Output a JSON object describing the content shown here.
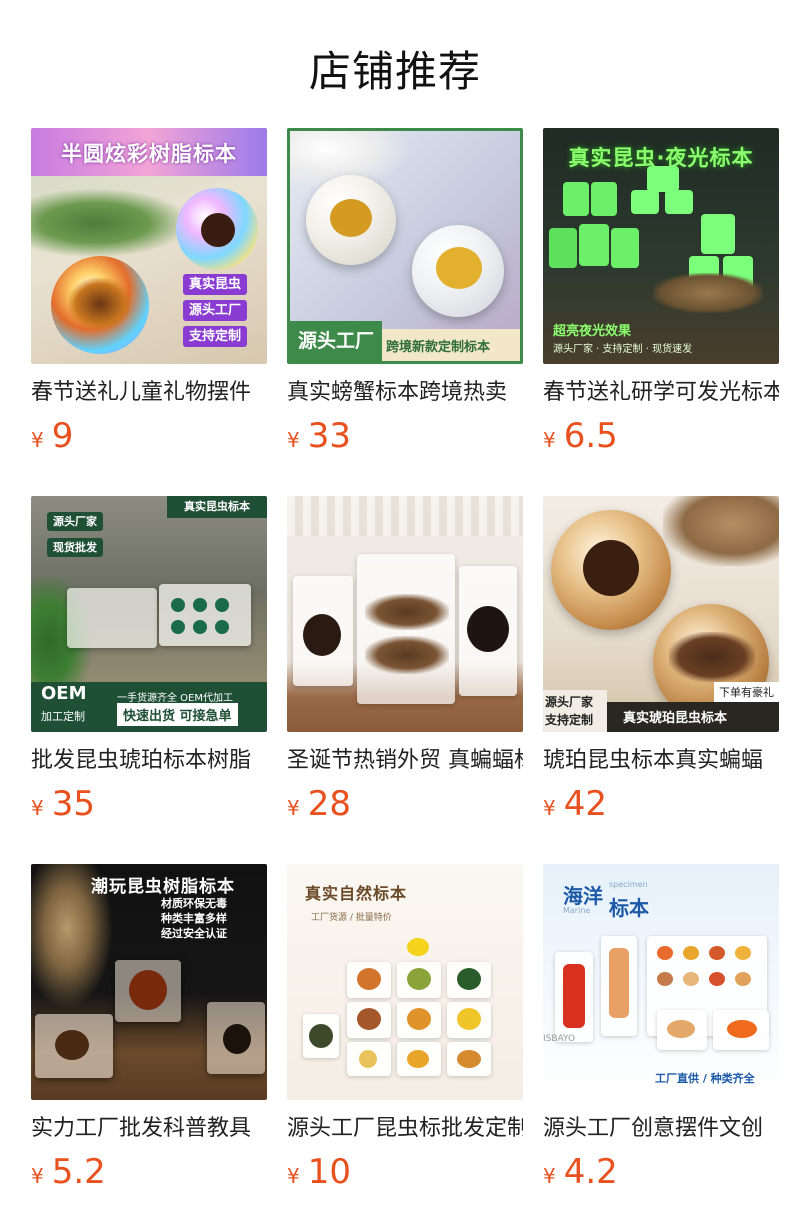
{
  "page": {
    "title": "店铺推荐"
  },
  "products": [
    {
      "name": "春节送礼儿童礼物摆件",
      "price_symbol": "¥",
      "price": "9",
      "image": {
        "headline": "半圆炫彩树脂标本",
        "tags": [
          "真实昆虫",
          "源头工厂",
          "支持定制"
        ]
      }
    },
    {
      "name": "真实螃蟹标本跨境热卖",
      "price_symbol": "¥",
      "price": "33",
      "image": {
        "banner_left": "源头工厂",
        "banner_right": "跨境新款定制标本"
      }
    },
    {
      "name": "春节送礼研学可发光标本",
      "price_symbol": "¥",
      "price": "6.5",
      "image": {
        "headline": "真实昆虫·夜光标本",
        "subline": "超亮夜光效果",
        "footer": "源头厂家 · 支持定制 · 现货速发"
      }
    },
    {
      "name": "批发昆虫琥珀标本树脂",
      "price_symbol": "¥",
      "price": "35",
      "image": {
        "corner": "真实昆虫标本",
        "tags": [
          "源头厂家",
          "现货批发"
        ],
        "oem": "OEM",
        "oem_sub": "加工定制",
        "strip_top": "一手货源齐全 OEM代加工",
        "strip_bottom": "快速出货 可接急单"
      }
    },
    {
      "name": "圣诞节热销外贸 真蝙蝠标本",
      "price_symbol": "¥",
      "price": "28",
      "image": {}
    },
    {
      "name": "琥珀昆虫标本真实蝙蝠",
      "price_symbol": "¥",
      "price": "42",
      "image": {
        "corner": "下单有豪礼",
        "left_line1": "源头厂家",
        "left_line2": "支持定制",
        "right": "真实琥珀昆虫标本"
      }
    },
    {
      "name": "实力工厂批发科普教具",
      "price_symbol": "¥",
      "price": "5.2",
      "image": {
        "headline": "潮玩昆虫树脂标本",
        "lines": [
          "材质环保无毒",
          "种类丰富多样",
          "经过安全认证"
        ]
      }
    },
    {
      "name": "源头工厂昆虫标批发定制",
      "price_symbol": "¥",
      "price": "10",
      "image": {
        "headline": "真实自然标本",
        "subline": "工厂货源 / 批量特价"
      }
    },
    {
      "name": "源头工厂创意摆件文创",
      "price_symbol": "¥",
      "price": "4.2",
      "image": {
        "headline_cn1": "海洋",
        "headline_cn2": "标本",
        "headline_en1": "specimen",
        "headline_en2": "Marine",
        "footer": "工厂直供 / 种类齐全",
        "box_text": "ISBAYO"
      }
    }
  ],
  "colors": {
    "price": "#e8501e",
    "title": "#111111",
    "name": "#222222"
  }
}
